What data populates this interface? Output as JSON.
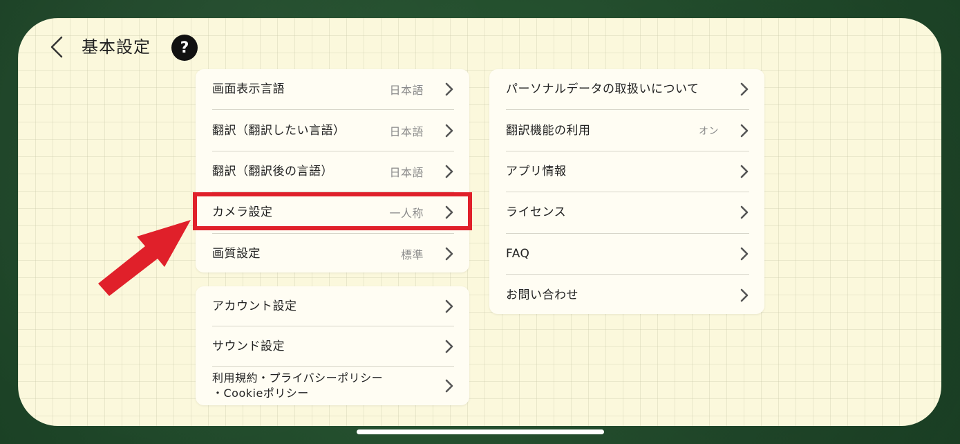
{
  "header": {
    "title": "基本設定",
    "help_label": "?"
  },
  "left_card_1": {
    "items": [
      {
        "label": "画面表示言語",
        "value": "日本語"
      },
      {
        "label": "翻訳（翻訳したい言語）",
        "value": "日本語"
      },
      {
        "label": "翻訳（翻訳後の言語）",
        "value": "日本語"
      },
      {
        "label": "カメラ設定",
        "value": "一人称"
      },
      {
        "label": "画質設定",
        "value": "標準"
      }
    ]
  },
  "left_card_2": {
    "items": [
      {
        "label": "アカウント設定"
      },
      {
        "label": "サウンド設定"
      },
      {
        "label": "利用規約・プライバシーポリシー\n・Cookieポリシー"
      }
    ]
  },
  "right_card": {
    "items": [
      {
        "label": "パーソナルデータの取扱いについて"
      },
      {
        "label": "翻訳機能の利用",
        "value": "オン"
      },
      {
        "label": "アプリ情報"
      },
      {
        "label": "ライセンス"
      },
      {
        "label": "FAQ"
      },
      {
        "label": "お問い合わせ"
      }
    ]
  },
  "icons": {
    "back": "chevron-left-icon",
    "help": "question-icon",
    "row_chevron": "chevron-right-icon"
  },
  "colors": {
    "highlight": "#e0202a",
    "background": "#fbf8dc",
    "card": "#fffdf3"
  }
}
